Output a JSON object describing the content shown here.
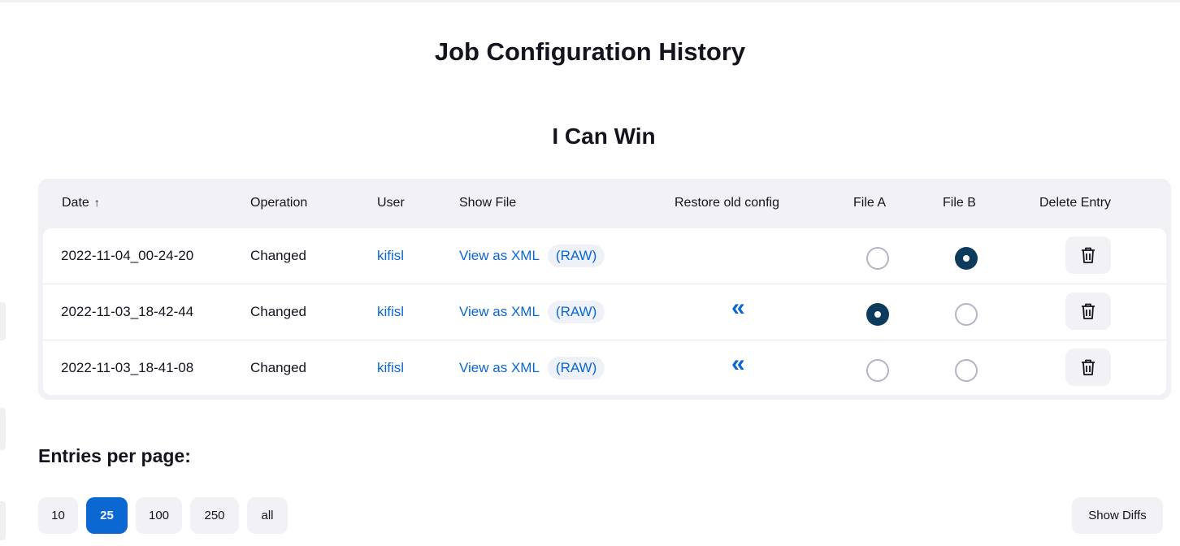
{
  "title": "Job Configuration History",
  "job_name": "I Can Win",
  "table": {
    "headers": {
      "date": "Date",
      "date_sort_indicator": "↑",
      "operation": "Operation",
      "user": "User",
      "show_file": "Show File",
      "restore": "Restore old config",
      "file_a": "File A",
      "file_b": "File B",
      "delete": "Delete Entry"
    },
    "rows": [
      {
        "date": "2022-11-04_00-24-20",
        "operation": "Changed",
        "user": "kifisl",
        "view_xml": "View as XML",
        "raw": "(RAW)",
        "restore_available": false,
        "file_a_selected": false,
        "file_b_selected": true
      },
      {
        "date": "2022-11-03_18-42-44",
        "operation": "Changed",
        "user": "kifisl",
        "view_xml": "View as XML",
        "raw": "(RAW)",
        "restore_available": true,
        "file_a_selected": true,
        "file_b_selected": false
      },
      {
        "date": "2022-11-03_18-41-08",
        "operation": "Changed",
        "user": "kifisl",
        "view_xml": "View as XML",
        "raw": "(RAW)",
        "restore_available": true,
        "file_a_selected": false,
        "file_b_selected": false
      }
    ],
    "restore_icon": "double-chevron-left-icon",
    "delete_icon": "trash-icon"
  },
  "pagination": {
    "label": "Entries per page:",
    "options": [
      "10",
      "25",
      "100",
      "250",
      "all"
    ],
    "selected": "25"
  },
  "show_diffs_label": "Show Diffs",
  "colors": {
    "accent": "#0b67d1",
    "radio_checked": "#0d3b5e",
    "surface": "#f2f2f6"
  }
}
